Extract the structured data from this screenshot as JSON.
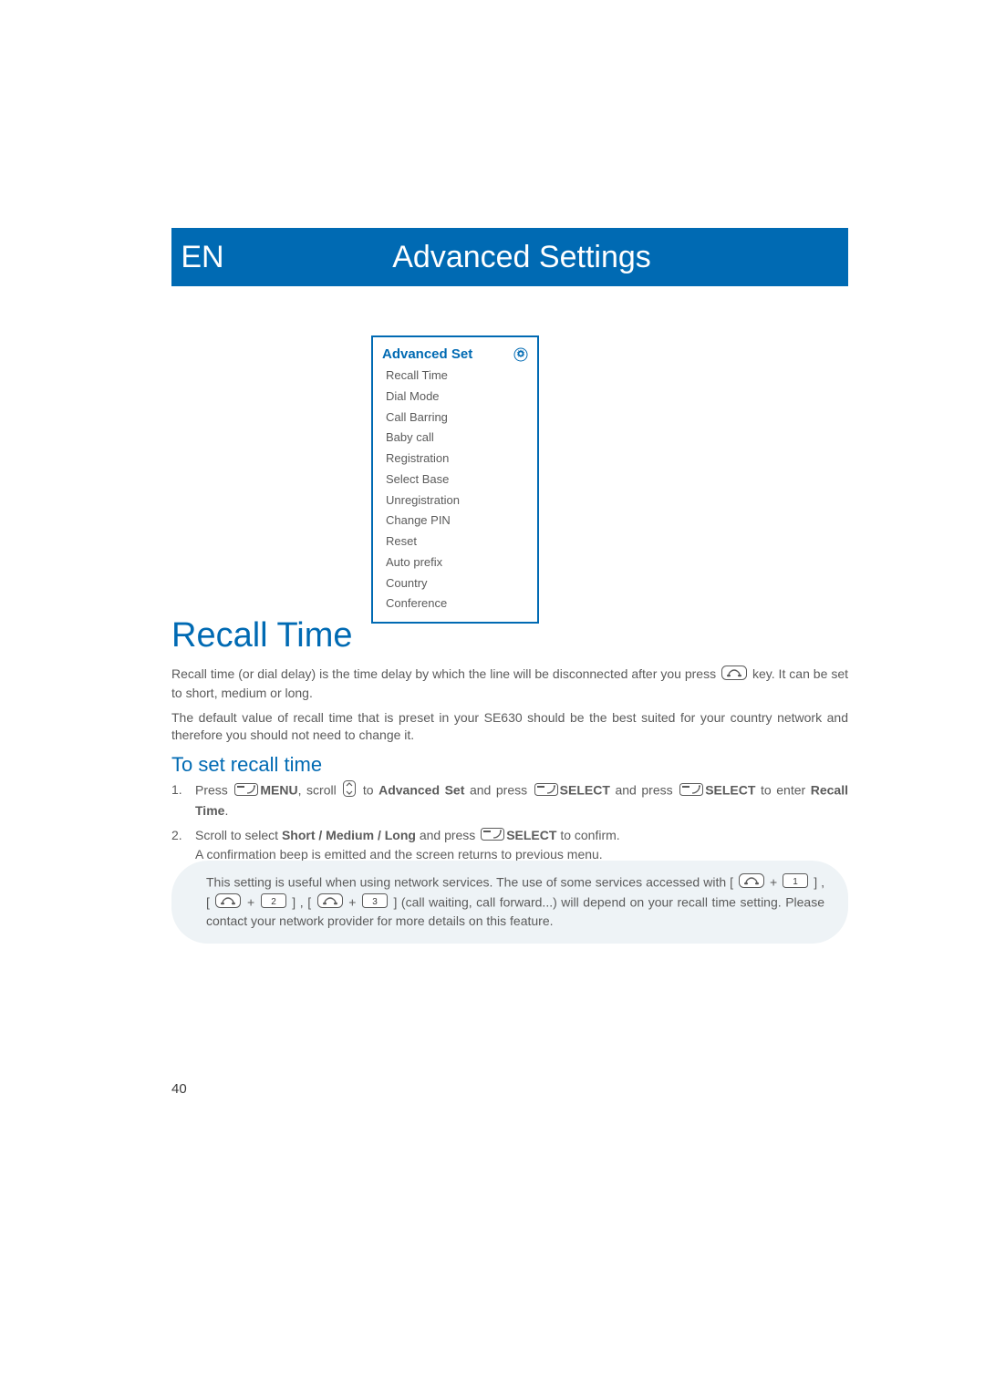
{
  "header": {
    "lang": "EN",
    "title": "Advanced Settings"
  },
  "menu": {
    "title": "Advanced Set",
    "items": [
      "Recall Time",
      "Dial Mode",
      "Call Barring",
      "Baby call",
      "Registration",
      "Select Base",
      "Unregistration",
      "Change PIN",
      "Reset",
      "Auto prefix",
      "Country",
      "Conference"
    ]
  },
  "section": {
    "title": "Recall Time",
    "para1_a": "Recall time (or dial delay) is the time delay by which the line will be disconnected after you press ",
    "para1_b": " key. It can be set to short, medium or long.",
    "para2": "The default value of recall time that is preset in your SE630 should be the best suited for your country network and therefore you should not need to change it.",
    "subheading": "To set recall time",
    "steps": {
      "s1": {
        "num": "1.",
        "a": "Press ",
        "menu": "MENU",
        "b": ", scroll ",
        "c": " to ",
        "adv": "Advanced Set",
        "d": " and press ",
        "sel1": "SELECT",
        "e": " and press ",
        "sel2": "SELECT",
        "f": " to enter ",
        "recall": "Recall Time",
        "g": "."
      },
      "s2": {
        "num": "2.",
        "a": "Scroll to select ",
        "opts": "Short / Medium / Long",
        "b": " and press ",
        "sel": "SELECT",
        "c": " to confirm.",
        "line2": "A confirmation beep is emitted and the screen returns to previous menu."
      }
    },
    "tip": {
      "a": "This setting is useful when using network services. The use of some services accessed with [ ",
      "plus": " + ",
      "b": " ] , [ ",
      "c": " ] , [ ",
      "d": " ] (call waiting, call forward...) will depend on your recall time setting. Please contact your network provider for more details on this feature."
    }
  },
  "page_number": "40"
}
